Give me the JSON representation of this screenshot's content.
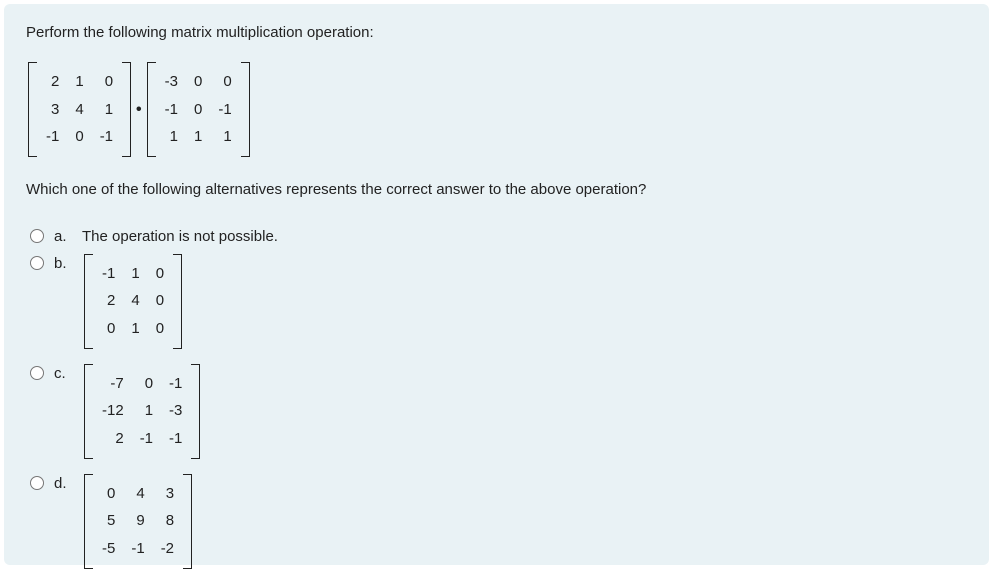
{
  "question": {
    "intro": "Perform the following matrix multiplication operation:",
    "matrix_left": {
      "r0c0": "2",
      "r0c1": "1",
      "r0c2": "0",
      "r1c0": "3",
      "r1c1": "4",
      "r1c2": "1",
      "r2c0": "-1",
      "r2c1": "0",
      "r2c2": "-1"
    },
    "operator_dot": "•",
    "matrix_right": {
      "r0c0": "-3",
      "r0c1": "0",
      "r0c2": "0",
      "r1c0": "-1",
      "r1c1": "0",
      "r1c2": "-1",
      "r2c0": "1",
      "r2c1": "1",
      "r2c2": "1"
    },
    "prompt2": "Which one of the following alternatives represents the correct answer to the above operation?"
  },
  "options": {
    "a": {
      "letter": "a.",
      "text": "The operation is not possible."
    },
    "b": {
      "letter": "b.",
      "matrix": {
        "r0c0": "-1",
        "r0c1": "1",
        "r0c2": "0",
        "r1c0": "2",
        "r1c1": "4",
        "r1c2": "0",
        "r2c0": "0",
        "r2c1": "1",
        "r2c2": "0"
      }
    },
    "c": {
      "letter": "c.",
      "matrix": {
        "r0c0": "-7",
        "r0c1": "0",
        "r0c2": "-1",
        "r1c0": "-12",
        "r1c1": "1",
        "r1c2": "-3",
        "r2c0": "2",
        "r2c1": "-1",
        "r2c2": "-1"
      }
    },
    "d": {
      "letter": "d.",
      "matrix": {
        "r0c0": "0",
        "r0c1": "4",
        "r0c2": "3",
        "r1c0": "5",
        "r1c1": "9",
        "r1c2": "8",
        "r2c0": "-5",
        "r2c1": "-1",
        "r2c2": "-2"
      }
    }
  }
}
